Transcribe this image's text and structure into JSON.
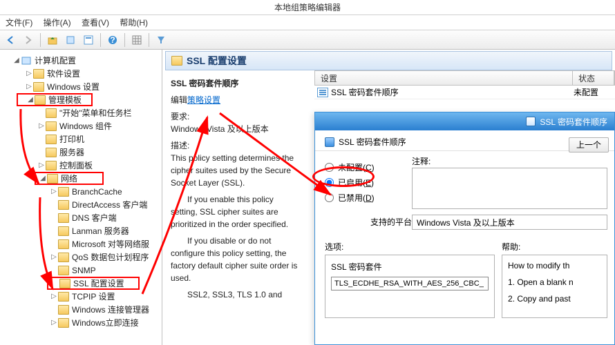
{
  "window": {
    "title": "本地组策略编辑器"
  },
  "menu": {
    "file": "文件(F)",
    "action": "操作(A)",
    "view": "查看(V)",
    "help": "帮助(H)"
  },
  "toolbar_icons": [
    "back",
    "forward",
    "up",
    "props",
    "refresh",
    "export",
    "help",
    "grid",
    "filter"
  ],
  "tree": {
    "root": "计算机配置",
    "l1a": "软件设置",
    "l1b": "Windows 设置",
    "l1c": "管理模板",
    "l2a": "\"开始\"菜单和任务栏",
    "l2b": "Windows 组件",
    "l2c": "打印机",
    "l2d": "服务器",
    "l2e": "控制面板",
    "l2f": "网络",
    "l3a": "BranchCache",
    "l3b": "DirectAccess 客户端",
    "l3c": "DNS 客户端",
    "l3d": "Lanman 服务器",
    "l3e": "Microsoft 对等网络服",
    "l3f": "QoS 数据包计划程序",
    "l3g": "SNMP",
    "l3h": "SSL 配置设置",
    "l3i": "TCPIP 设置",
    "l3j": "Windows 连接管理器",
    "l3k": "Windows立即连接"
  },
  "content": {
    "header": "SSL 配置设置",
    "subtitle": "SSL 密码套件顺序",
    "edit_prefix": "编辑",
    "edit_link": "策略设置",
    "req_label": "要求:",
    "req_val": "Windows Vista 及以上版本",
    "desc_label": "描述:",
    "desc1": "This policy setting determines the cipher suites used by the Secure Socket Layer (SSL).",
    "desc2": "If you enable this policy setting, SSL cipher suites are prioritized in the order specified.",
    "desc3": "If you disable or do not configure this policy setting, the factory default cipher suite order is used.",
    "desc4": "SSL2, SSL3, TLS 1.0 and"
  },
  "grid": {
    "col_setting": "设置",
    "col_state": "状态",
    "row1_name": "SSL 密码套件顺序",
    "row1_state": "未配置"
  },
  "dialog": {
    "title": "SSL 密码套件顺序",
    "sub": "SSL 密码套件顺序",
    "prev_btn": "上一个",
    "radio_unconf": "未配置(C)",
    "radio_enabled": "已启用(E)",
    "radio_disabled": "已禁用(D)",
    "note_label": "注释:",
    "platform_label": "支持的平台:",
    "platform_val": "Windows Vista 及以上版本",
    "options_label": "选项:",
    "help_label": "帮助:",
    "opt_field_label": "SSL 密码套件",
    "opt_field_value": "TLS_ECDHE_RSA_WITH_AES_256_CBC_",
    "help_text1": "How to modify th",
    "help_text2": "1. Open a blank n",
    "help_text3": "2. Copy and past"
  }
}
